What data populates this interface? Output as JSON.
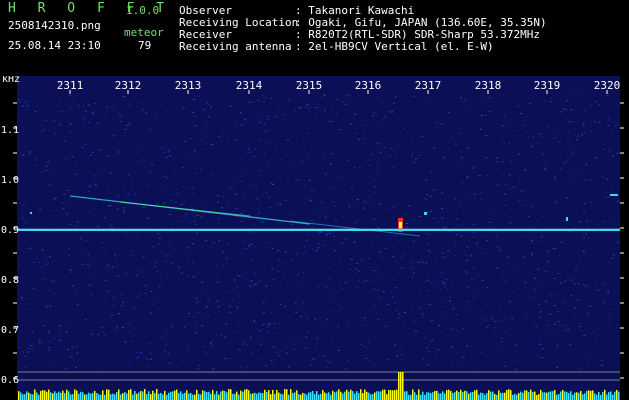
{
  "header": {
    "app_title": "H R O F F T",
    "version": "1.0.0",
    "filename": "2508142310.png",
    "timestamp": "25.08.14 23:10",
    "count_label": "meteor",
    "count_value": "79",
    "observer_label": "Observer",
    "observer_value": ": Takanori Kawachi",
    "location_label": "Receiving Location",
    "location_value": ": Ogaki, Gifu, JAPAN (136.60E, 35.35N)",
    "receiver_label": "Receiver",
    "receiver_value": ": R820T2(RTL-SDR) SDR-Sharp 53.372MHz",
    "antenna_label": "Receiving antenna",
    "antenna_value": ": 2el-HB9CV Vertical (el. E-W)"
  },
  "axes": {
    "y_unit": "kHz",
    "x_ticks": [
      "2311",
      "2312",
      "2313",
      "2314",
      "2315",
      "2316",
      "2317",
      "2318",
      "2319",
      "2320"
    ],
    "y_ticks": [
      "1.1",
      "1.0",
      "0.9",
      "0.8",
      "0.7",
      "0.6"
    ],
    "y_minor_ticks": [
      "1.05",
      "0.95",
      "0.85",
      "0.75",
      "0.65"
    ]
  },
  "colors": {
    "background": "#000000",
    "header_text": "#ffffff",
    "accent_text": "#6fe06f",
    "noise": "#141a7a",
    "carrier": "#39d6ff",
    "meteor_head": "#ff2a2a",
    "bottom_bars": "#3fe0ff",
    "bottom_bars_peak": "#ffff00",
    "gridline": "#808080"
  }
}
